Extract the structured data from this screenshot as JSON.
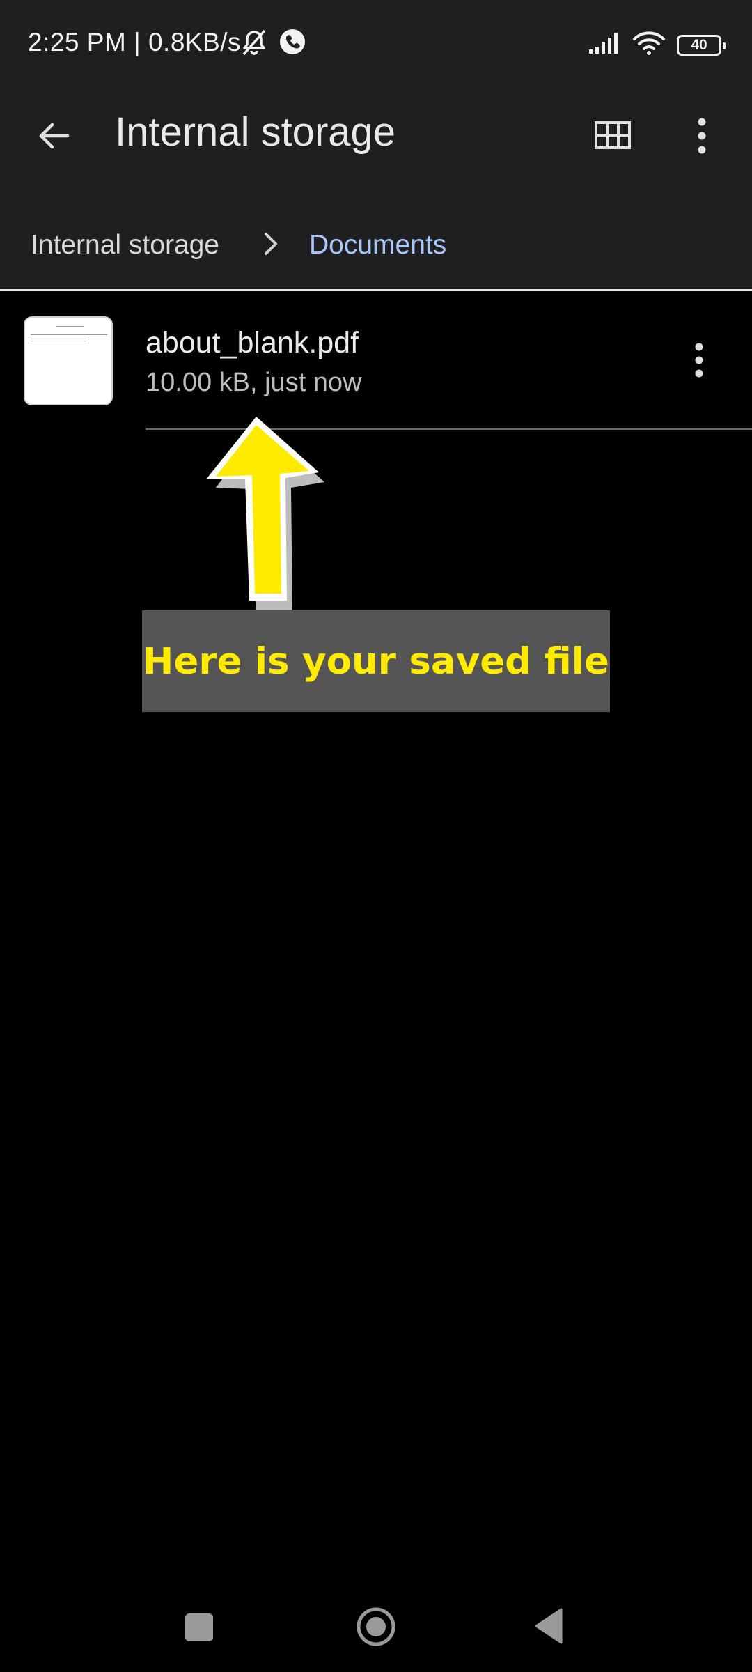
{
  "status_bar": {
    "time_speed": "2:25 PM | 0.8KB/s",
    "icons": [
      "mute-icon",
      "call-icon",
      "signal-icon",
      "wifi-icon",
      "battery-icon"
    ],
    "battery_level": "40"
  },
  "app_bar": {
    "title": "Internal storage",
    "icons": [
      "back-arrow-icon",
      "grid-view-icon",
      "more-vert-icon"
    ]
  },
  "breadcrumb": {
    "root": "Internal storage",
    "current": "Documents",
    "separator_icon": "chevron-right-icon"
  },
  "files": [
    {
      "name": "about_blank.pdf",
      "meta": "10.00 kB, just now",
      "thumbnail_icon": "pdf-thumbnail",
      "menu_icon": "more-vert-icon"
    }
  ],
  "overlay": {
    "callout_text": "Here is your saved file",
    "arrow_icon": "up-arrow-annotation",
    "arrow_color": "#ffea00",
    "callout_bg": "#555555"
  },
  "nav_bar": {
    "icons": [
      "recents-square-icon",
      "home-circle-icon",
      "back-triangle-icon"
    ]
  },
  "colors": {
    "surface": "#1f1f21",
    "background": "#000000",
    "accent_link": "#a8c7fa",
    "text_primary": "#eaeaea",
    "text_secondary": "#bdbdbd"
  }
}
